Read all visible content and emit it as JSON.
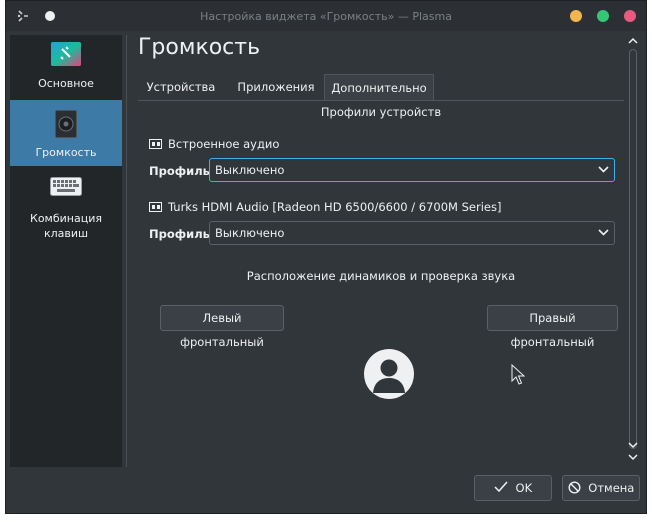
{
  "window": {
    "title": "Настройка виджета «Громкость» — Plasma",
    "controls": {
      "minimize_color": "#f3b64f",
      "maximize_color": "#35c676",
      "close_color": "#e85a80"
    }
  },
  "sidebar": {
    "items": [
      {
        "label": "Основное",
        "icon": "general-settings-icon"
      },
      {
        "label": "Громкость",
        "icon": "speaker-icon"
      },
      {
        "label": "Комбинация клавиш",
        "icon": "keyboard-icon"
      }
    ]
  },
  "page": {
    "title": "Громкость",
    "tabs": [
      {
        "label": "Устройства"
      },
      {
        "label": "Приложения"
      },
      {
        "label": "Дополнительно"
      }
    ],
    "section_title": "Профили устройств",
    "devices": [
      {
        "name": "Встроенное аудио",
        "profile_label": "Профиль:",
        "profile_value": "Выключено"
      },
      {
        "name": "Turks HDMI Audio [Radeon HD 6500/6600 / 6700M Series]",
        "profile_label": "Профиль:",
        "profile_value": "Выключено"
      }
    ],
    "speaker_section_title": "Расположение динамиков и проверка звука",
    "left_speaker": "Левый фронтальный",
    "right_speaker": "Правый фронтальный"
  },
  "footer": {
    "ok_label": "OK",
    "cancel_label": "Отмена"
  },
  "colors": {
    "accent": "#3daee9",
    "selection": "#3d7aa6",
    "background": "#31363b"
  }
}
